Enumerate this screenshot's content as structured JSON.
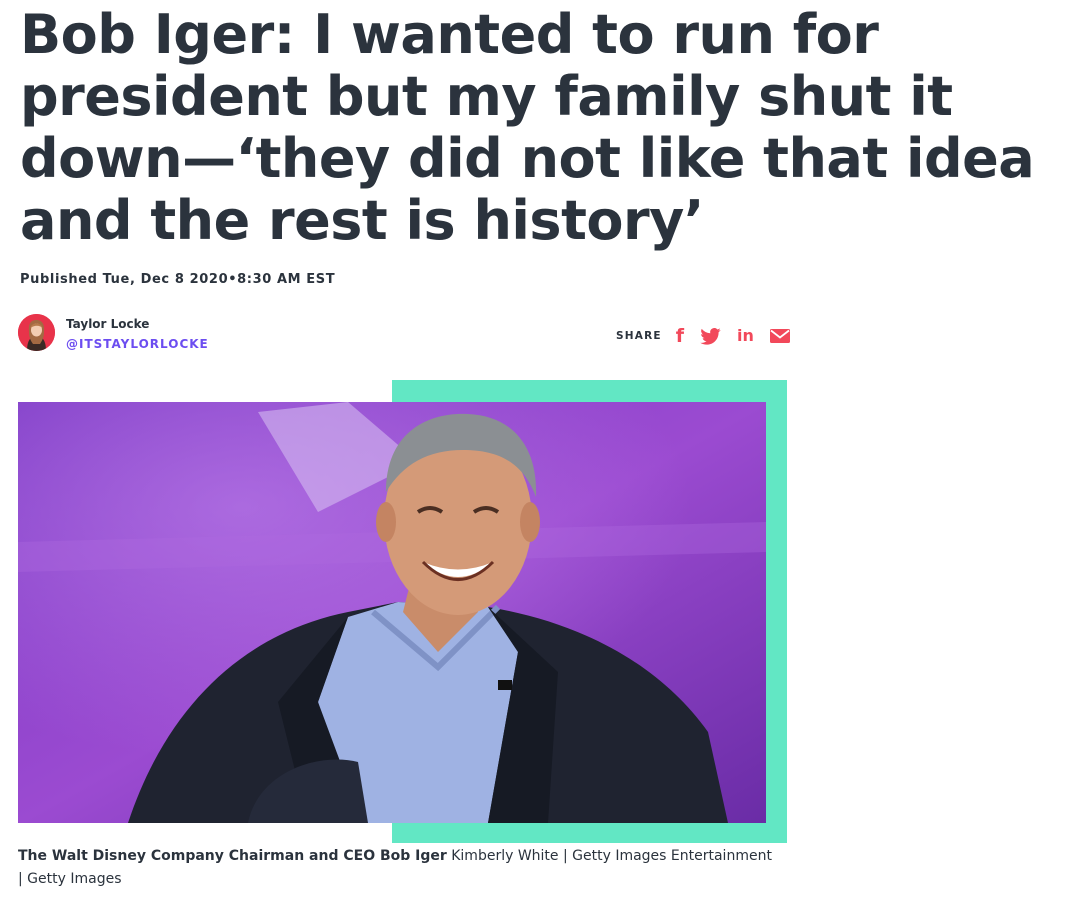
{
  "article": {
    "headline": "Bob Iger: I wanted to run for president but my family shut it down—‘they did not like that idea and the rest is history’",
    "published": "Published Tue, Dec 8 2020•8:30 AM EST"
  },
  "author": {
    "name": "Taylor Locke",
    "handle": "@ITSTAYLORLOCKE"
  },
  "share": {
    "label": "SHARE",
    "buttons": [
      {
        "icon": "facebook-icon",
        "glyph": "f"
      },
      {
        "icon": "twitter-icon"
      },
      {
        "icon": "linkedin-icon",
        "glyph": "in"
      },
      {
        "icon": "email-icon"
      }
    ]
  },
  "image": {
    "caption_bold": "The Walt Disney Company Chairman and CEO Bob Iger",
    "caption_credit": " Kimberly White | Getty Images Entertainment | Getty Images"
  },
  "colors": {
    "text": "#2b333d",
    "accent": "#62e7c4",
    "handle": "#6c4df0",
    "share_icons": "#f2485a"
  }
}
